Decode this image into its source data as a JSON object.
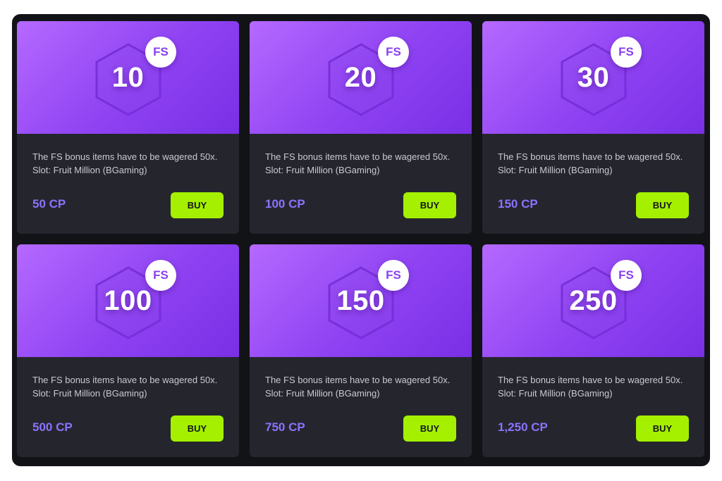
{
  "colors": {
    "frame_background": "#121317",
    "card_background": "#25262d",
    "banner_gradient_start": "#b569ff",
    "banner_gradient_end": "#7a2fe6",
    "price_text": "#8b72ff",
    "buy_button": "#a4f000",
    "badge_text": "#8a3ff0"
  },
  "icons": {
    "banner_shape": "hexagon-icon",
    "badge": "fs-badge"
  },
  "cards": [
    {
      "amount": "10",
      "badge": "FS",
      "description_line1": "The FS bonus items have to be wagered 50x.",
      "description_line2": "Slot: Fruit Million (BGaming)",
      "price": "50 CP",
      "buy_label": "BUY"
    },
    {
      "amount": "20",
      "badge": "FS",
      "description_line1": "The FS bonus items have to be wagered 50x.",
      "description_line2": "Slot: Fruit Million (BGaming)",
      "price": "100 CP",
      "buy_label": "BUY"
    },
    {
      "amount": "30",
      "badge": "FS",
      "description_line1": "The FS bonus items have to be wagered 50x.",
      "description_line2": "Slot: Fruit Million (BGaming)",
      "price": "150 CP",
      "buy_label": "BUY"
    },
    {
      "amount": "100",
      "badge": "FS",
      "description_line1": "The FS bonus items have to be wagered 50x.",
      "description_line2": "Slot: Fruit Million (BGaming)",
      "price": "500 CP",
      "buy_label": "BUY"
    },
    {
      "amount": "150",
      "badge": "FS",
      "description_line1": "The FS bonus items have to be wagered 50x.",
      "description_line2": "Slot: Fruit Million (BGaming)",
      "price": "750 CP",
      "buy_label": "BUY"
    },
    {
      "amount": "250",
      "badge": "FS",
      "description_line1": "The FS bonus items have to be wagered 50x.",
      "description_line2": "Slot: Fruit Million (BGaming)",
      "price": "1,250 CP",
      "buy_label": "BUY"
    }
  ]
}
